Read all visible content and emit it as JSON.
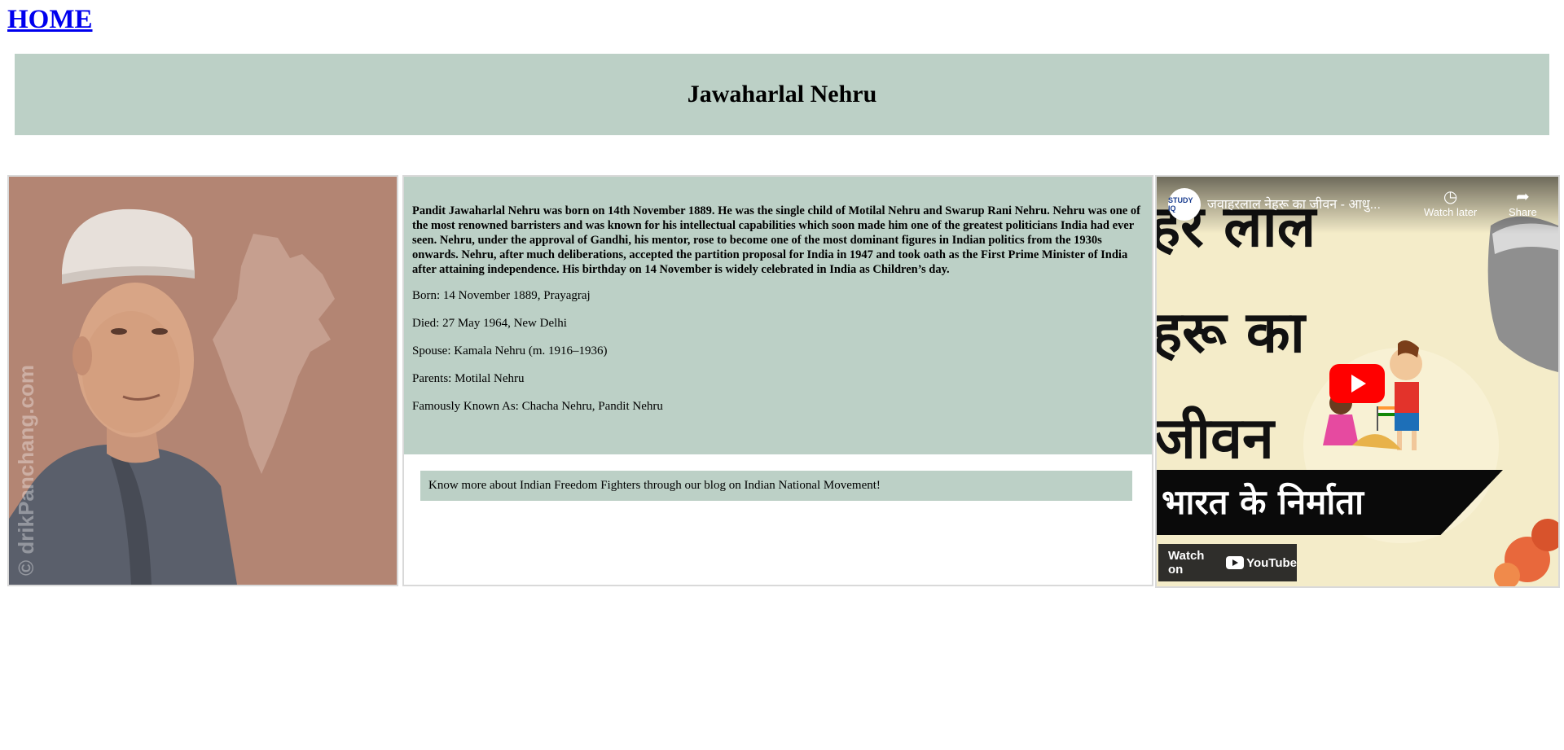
{
  "nav": {
    "home_label": "HOME"
  },
  "banner": {
    "title": "Jawaharlal Nehru"
  },
  "photo": {
    "watermark": "© drikPanchang.com"
  },
  "info": {
    "bio": "Pandit Jawaharlal Nehru was born on 14th November 1889. He was the single child of Motilal Nehru and Swarup Rani Nehru. Nehru was one of the most renowned barristers and was known for his intellectual capabilities which soon made him one of the greatest politicians India had ever seen. Nehru, under the approval of Gandhi, his mentor, rose to become one of the most dominant figures in Indian politics from the 1930s onwards. Nehru, after much deliberations, accepted the partition proposal for India in 1947 and took oath as the First Prime Minister of India after attaining independence. His birthday on 14 November is widely celebrated in India as Children’s day.",
    "facts": [
      "Born: 14 November 1889, Prayagraj",
      "Died: 27 May 1964, New Delhi",
      "Spouse: Kamala Nehru (m. 1916–1936)",
      "Parents: Motilal Nehru",
      "Famously Known As: Chacha Nehru, Pandit Nehru"
    ],
    "blog_link": "Know more about Indian Freedom Fighters through our blog on Indian National Movement!"
  },
  "video": {
    "channel_logo_text": "STUDY IQ",
    "title": "जवाहरलाल नेहरू का जीवन - आधु...",
    "watch_later_label": "Watch later",
    "share_label": "Share",
    "thumbnail_lines": [
      "हर लाल",
      "हरू का",
      "जीवन"
    ],
    "strip_text": "भारत के निर्माता",
    "watch_on_label": "Watch on",
    "youtube_label": "YouTube"
  },
  "colors": {
    "panel_bg": "#bcd0c6",
    "link": "#0000ee",
    "yt_red": "#ff0000"
  }
}
